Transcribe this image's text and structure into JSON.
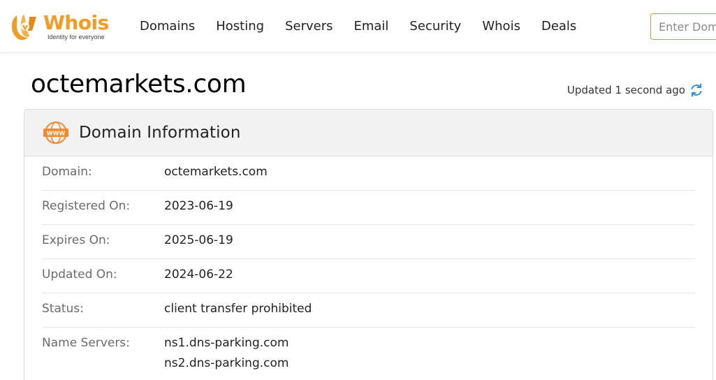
{
  "brand": {
    "name": "Whois",
    "tagline": "Identity for everyone",
    "accent_color": "#f59a23",
    "icon": "whois-logo-icon"
  },
  "nav": {
    "items": [
      {
        "label": "Domains"
      },
      {
        "label": "Hosting"
      },
      {
        "label": "Servers"
      },
      {
        "label": "Email"
      },
      {
        "label": "Security"
      },
      {
        "label": "Whois"
      },
      {
        "label": "Deals"
      }
    ]
  },
  "search": {
    "placeholder": "Enter Domain or IP"
  },
  "page": {
    "title": "octemarkets.com",
    "updated_text": "Updated 1 second ago",
    "refresh_icon": "refresh-icon",
    "refresh_color": "#2f8fe6"
  },
  "domain_info": {
    "title": "Domain Information",
    "icon": "www-icon",
    "rows": [
      {
        "label": "Domain:",
        "value": "octemarkets.com"
      },
      {
        "label": "Registered On:",
        "value": "2023-06-19"
      },
      {
        "label": "Expires On:",
        "value": "2025-06-19"
      },
      {
        "label": "Updated On:",
        "value": "2024-06-22"
      },
      {
        "label": "Status:",
        "value": "client transfer prohibited"
      },
      {
        "label": "Name Servers:",
        "values": [
          "ns1.dns-parking.com",
          "ns2.dns-parking.com"
        ]
      }
    ]
  }
}
